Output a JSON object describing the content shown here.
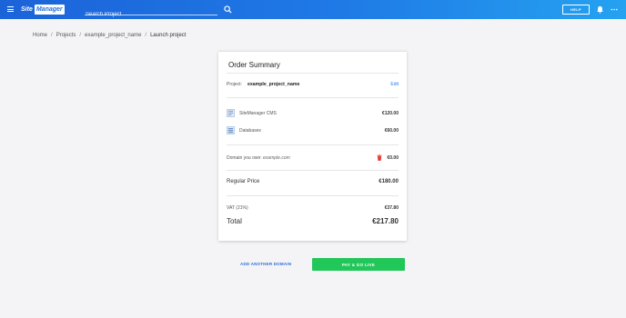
{
  "header": {
    "logo_site": "Site",
    "logo_manager": "Manager",
    "search_placeholder": "Search Project",
    "help_label": "HELP"
  },
  "breadcrumb": [
    "Home",
    "Projects",
    "example_project_name",
    "Launch project"
  ],
  "order": {
    "title": "Order Summary",
    "project_label": "Project:",
    "project_name": "example_project_name",
    "edit_label": "Edit",
    "items": [
      {
        "label": "SiteManager CMS",
        "price": "€120.00",
        "icon": "cms-icon"
      },
      {
        "label": "Databases",
        "price": "€60.00",
        "icon": "database-icon"
      }
    ],
    "domain_label": "Domain you own:",
    "domain_value": "example.com",
    "domain_price": "€0.00",
    "regular_label": "Regular Price",
    "regular_value": "€180.00",
    "vat_label": "VAT (21%)",
    "vat_value": "€37.80",
    "total_label": "Total",
    "total_value": "€217.80"
  },
  "actions": {
    "add_domain": "ADD ANOTHER DOMAIN",
    "pay": "PAY & GO LIVE"
  },
  "colors": {
    "header_start": "#1b63d9",
    "header_end": "#25a2f0",
    "pay_button": "#22c75a",
    "link": "#2b7de9",
    "trash": "#e53935"
  }
}
